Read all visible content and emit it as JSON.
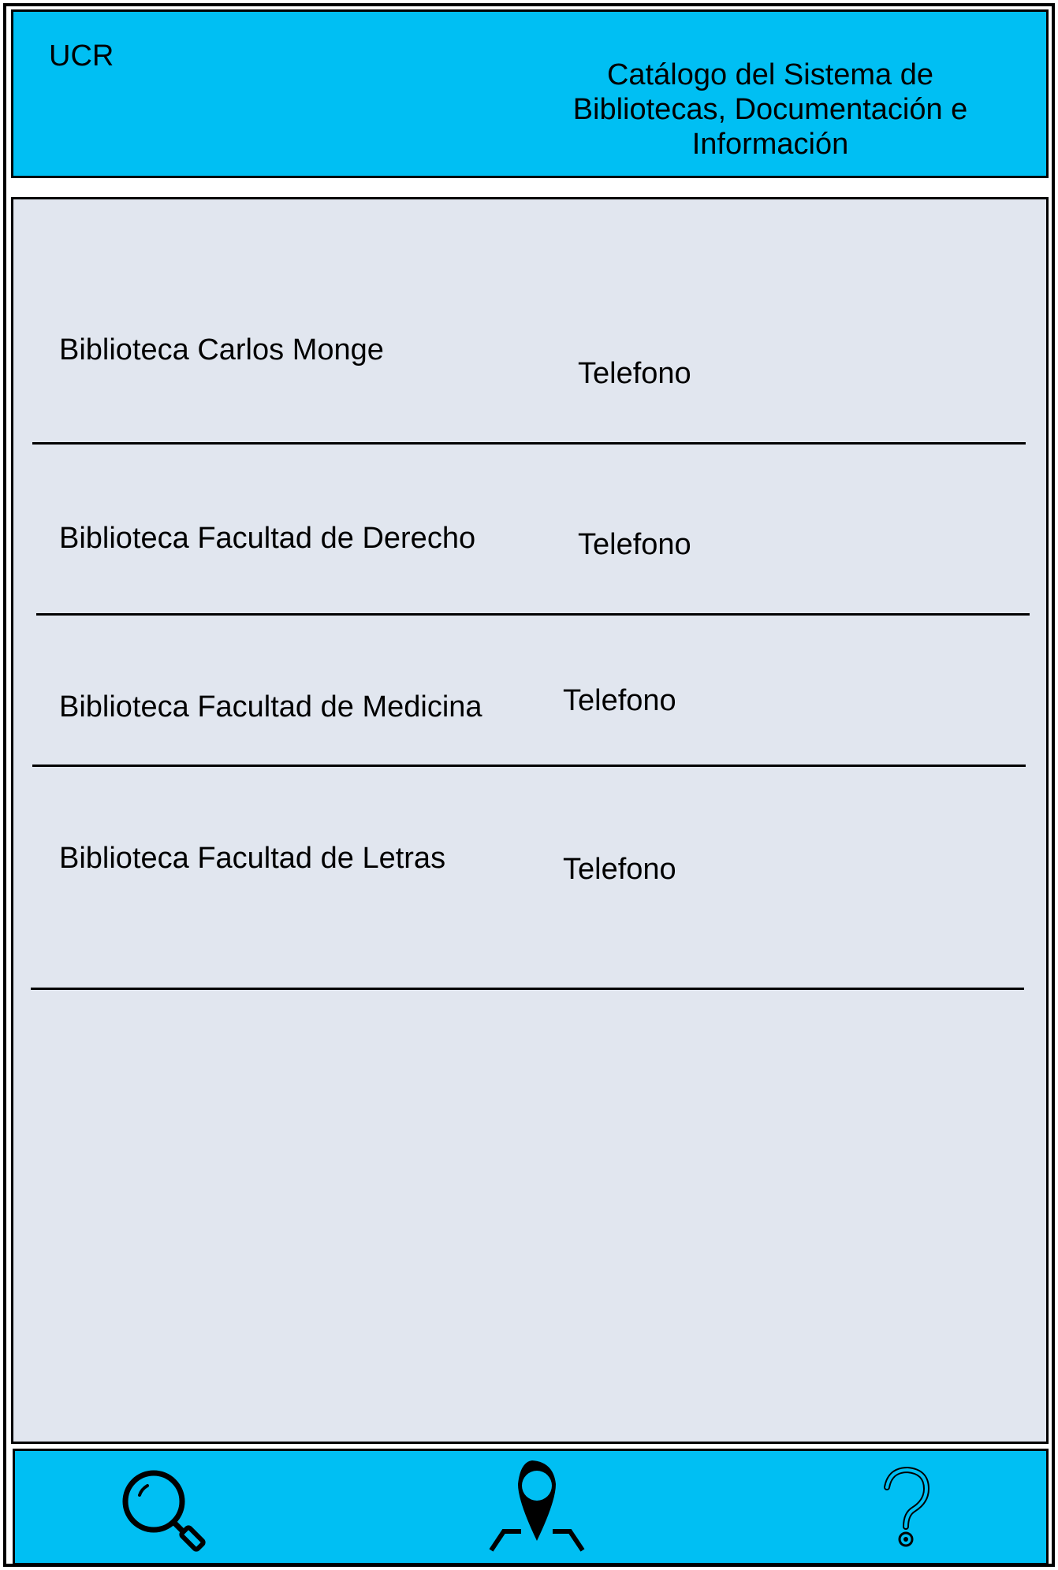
{
  "header": {
    "brand": "UCR",
    "title": "Catálogo del Sistema de Bibliotecas, Documentación e Información"
  },
  "libraries": [
    {
      "name": "Biblioteca Carlos Monge",
      "phone_label": "Telefono"
    },
    {
      "name": "Biblioteca Facultad de Derecho",
      "phone_label": "Telefono"
    },
    {
      "name": "Biblioteca Facultad de Medicina",
      "phone_label": "Telefono"
    },
    {
      "name": "Biblioteca Facultad de Letras",
      "phone_label": "Telefono"
    }
  ],
  "nav": {
    "items": [
      {
        "icon": "search-icon"
      },
      {
        "icon": "map-pin-icon"
      },
      {
        "icon": "help-icon"
      }
    ]
  },
  "colors": {
    "accent": "#00bff3",
    "content_bg": "#e1e6ef",
    "border": "#000000"
  }
}
